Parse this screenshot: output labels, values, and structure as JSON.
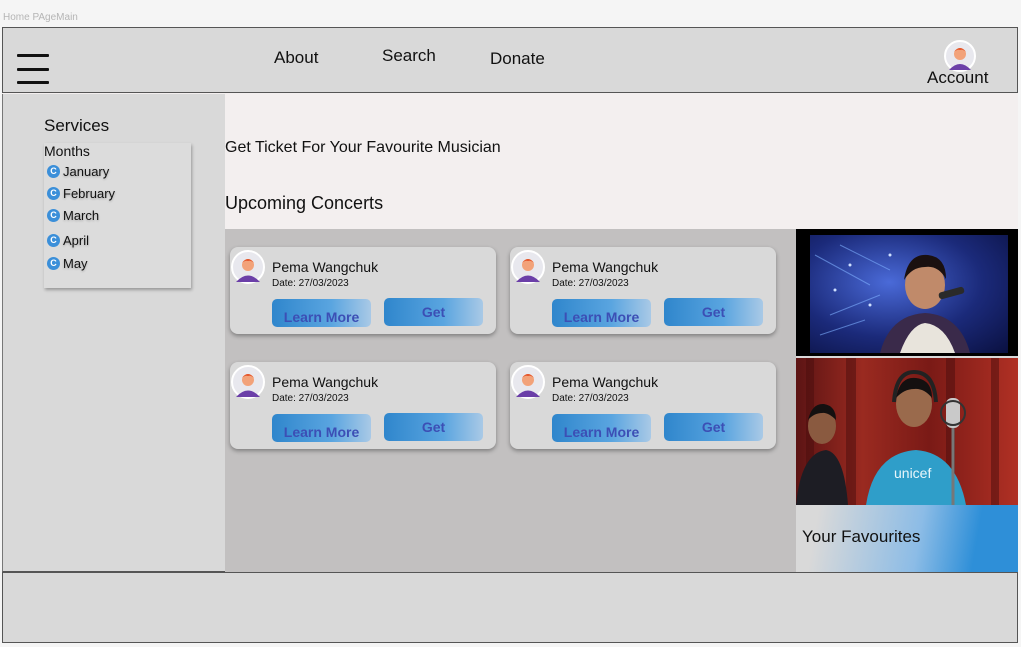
{
  "frame_label": "Home PAgeMain",
  "nav": {
    "links": [
      "About",
      "Search",
      "Donate"
    ],
    "account_label": "Account"
  },
  "sidebar": {
    "title": "Services",
    "months_title": "Months",
    "months": [
      "January",
      "February",
      "March",
      "April",
      "May"
    ]
  },
  "main": {
    "hero_text": "Get Ticket  For Your Favourite Musician",
    "section_title": "Upcoming Concerts",
    "cards": [
      {
        "name": "Pema Wangchuk",
        "date": "Date: 27/03/2023",
        "learn_more": "Learn More",
        "get": "Get"
      },
      {
        "name": "Pema Wangchuk",
        "date": "Date: 27/03/2023",
        "learn_more": "Learn More",
        "get": "Get"
      },
      {
        "name": "Pema Wangchuk",
        "date": "Date: 27/03/2023",
        "learn_more": "Learn More",
        "get": "Get"
      },
      {
        "name": "Pema Wangchuk",
        "date": "Date: 27/03/2023",
        "learn_more": "Learn More",
        "get": "Get"
      }
    ]
  },
  "favourites": {
    "label": "Your Favourites"
  },
  "colors": {
    "accent": "#2f86cc",
    "button_text": "#3c4fb5",
    "panel": "#d9d9d9"
  }
}
